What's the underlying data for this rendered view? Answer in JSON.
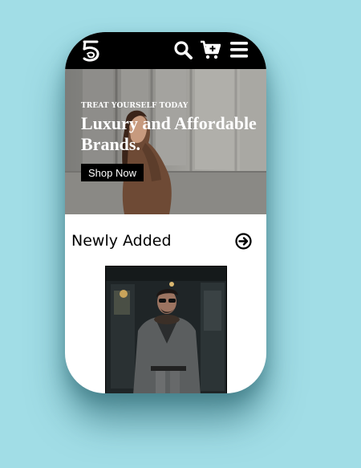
{
  "header": {
    "logo_icon": "five-logo-icon",
    "icons": [
      "search-icon",
      "cart-add-icon",
      "hamburger-menu-icon"
    ]
  },
  "hero": {
    "tagline": "TREAT YOURSELF TODAY",
    "title": "Luxury and Affordable Brands.",
    "cta_label": "Shop Now"
  },
  "newly_added": {
    "title": "Newly Added",
    "arrow_icon": "arrow-right-circle-icon",
    "product_image": "man-in-grey-coat-photo"
  },
  "colors": {
    "page_background": "#a1dde6",
    "header_background": "#000000",
    "accent_button": "#000000",
    "text_light": "#ffffff"
  }
}
